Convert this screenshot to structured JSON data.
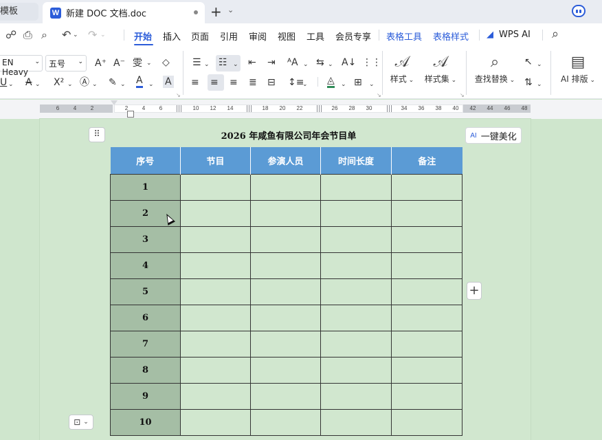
{
  "tabs": {
    "prev_label": "模板",
    "active_logo": "W",
    "active_title": "新建 DOC 文档.doc",
    "new_tab": "+",
    "dropdown": "⌄"
  },
  "menubar": {
    "quick": [
      "share-icon",
      "print-icon",
      "print-preview-icon",
      "undo-icon",
      "redo-icon"
    ],
    "items": [
      {
        "label": "开始",
        "state": "active"
      },
      {
        "label": "插入"
      },
      {
        "label": "页面"
      },
      {
        "label": "引用"
      },
      {
        "label": "审阅"
      },
      {
        "label": "视图"
      },
      {
        "label": "工具"
      },
      {
        "label": "会员专享"
      },
      {
        "label": "表格工具",
        "state": "blue"
      },
      {
        "label": "表格样式",
        "state": "blue"
      },
      {
        "label": "WPS AI",
        "state": "plain"
      }
    ],
    "search_icon": "⌕"
  },
  "ribbon": {
    "font_name": "EN Heavy",
    "font_size": "五号",
    "style_label": "样式",
    "style_set_label": "样式集",
    "find_replace_label": "查找替换",
    "ai_layout_label": "AI 排版"
  },
  "ruler": {
    "numbers": [
      "6",
      "4",
      "2",
      "2",
      "4",
      "6",
      "10",
      "12",
      "14",
      "18",
      "20",
      "22",
      "26",
      "28",
      "30",
      "34",
      "36",
      "38",
      "40",
      "42",
      "44",
      "46",
      "48"
    ]
  },
  "document": {
    "title": "2026 年咸鱼有限公司年会节目单",
    "ai_beautify_tag": "AI",
    "ai_beautify_label": "一键美化",
    "table": {
      "headers": [
        "序号",
        "节目",
        "参演人员",
        "时间长度",
        "备注"
      ],
      "rows": [
        [
          "1",
          "",
          "",
          "",
          ""
        ],
        [
          "2",
          "",
          "",
          "",
          ""
        ],
        [
          "3",
          "",
          "",
          "",
          ""
        ],
        [
          "4",
          "",
          "",
          "",
          ""
        ],
        [
          "5",
          "",
          "",
          "",
          ""
        ],
        [
          "6",
          "",
          "",
          "",
          ""
        ],
        [
          "7",
          "",
          "",
          "",
          ""
        ],
        [
          "8",
          "",
          "",
          "",
          ""
        ],
        [
          "9",
          "",
          "",
          "",
          ""
        ],
        [
          "10",
          "",
          "",
          "",
          ""
        ]
      ]
    }
  },
  "colors": {
    "accent": "#2b5cd9",
    "header_fill": "#5b9bd5",
    "number_column_fill": "#a5bea5",
    "page_fill": "#d1e7cf"
  }
}
